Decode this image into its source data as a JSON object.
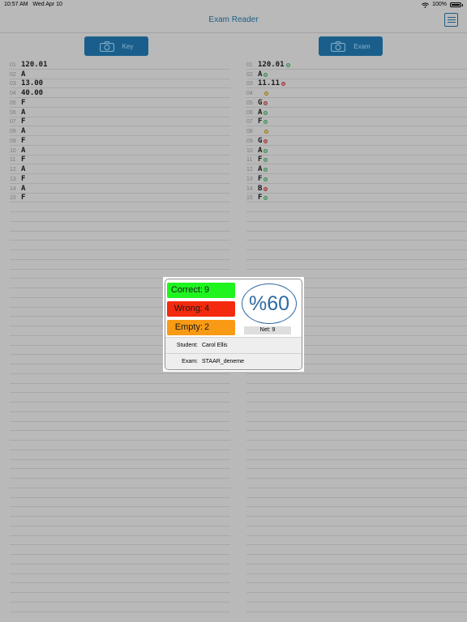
{
  "status_bar": {
    "time": "10:57 AM",
    "date": "Wed Apr 10",
    "battery": "100%",
    "wifi_icon": "wifi-icon"
  },
  "nav": {
    "title": "Exam Reader",
    "menu_icon": "list-icon"
  },
  "buttons": {
    "key_label": "Key",
    "exam_label": "Exam",
    "icon": "camera-icon"
  },
  "key_answers": [
    {
      "num": "01",
      "val": "120.01"
    },
    {
      "num": "02",
      "val": "A"
    },
    {
      "num": "03",
      "val": "13.00"
    },
    {
      "num": "04",
      "val": "40.00"
    },
    {
      "num": "05",
      "val": "F"
    },
    {
      "num": "06",
      "val": "A"
    },
    {
      "num": "07",
      "val": "F"
    },
    {
      "num": "08",
      "val": "A"
    },
    {
      "num": "09",
      "val": "F"
    },
    {
      "num": "10",
      "val": "A"
    },
    {
      "num": "11",
      "val": "F"
    },
    {
      "num": "12",
      "val": "A"
    },
    {
      "num": "13",
      "val": "F"
    },
    {
      "num": "14",
      "val": "A"
    },
    {
      "num": "15",
      "val": "F"
    }
  ],
  "exam_answers": [
    {
      "num": "01",
      "val": "120.01",
      "mark": "ok"
    },
    {
      "num": "02",
      "val": "A",
      "mark": "ok"
    },
    {
      "num": "03",
      "val": "11.11",
      "mark": "bad"
    },
    {
      "num": "04",
      "val": "",
      "mark": "empty"
    },
    {
      "num": "05",
      "val": "G",
      "mark": "bad"
    },
    {
      "num": "06",
      "val": "A",
      "mark": "ok"
    },
    {
      "num": "07",
      "val": "F",
      "mark": "ok"
    },
    {
      "num": "08",
      "val": "",
      "mark": "empty"
    },
    {
      "num": "09",
      "val": "G",
      "mark": "bad"
    },
    {
      "num": "10",
      "val": "A",
      "mark": "ok"
    },
    {
      "num": "11",
      "val": "F",
      "mark": "ok"
    },
    {
      "num": "12",
      "val": "A",
      "mark": "ok"
    },
    {
      "num": "13",
      "val": "F",
      "mark": "ok"
    },
    {
      "num": "14",
      "val": "B",
      "mark": "bad"
    },
    {
      "num": "15",
      "val": "F",
      "mark": "ok"
    }
  ],
  "result": {
    "correct_label": "Correct:",
    "correct": "9",
    "wrong_label": "Wrong:",
    "wrong": "4",
    "empty_label": "Empty:",
    "empty": "2",
    "score": "%60",
    "net": "Net: 9",
    "student_label": "Student:",
    "student": "Carol Ellis",
    "exam_label": "Exam:",
    "exam": "STAAR_deneme"
  },
  "colors": {
    "correct": "#1ff41f",
    "wrong": "#f32a0e",
    "empty": "#f89a14",
    "accent": "#1a5f8c",
    "score": "#2f6aa3"
  }
}
